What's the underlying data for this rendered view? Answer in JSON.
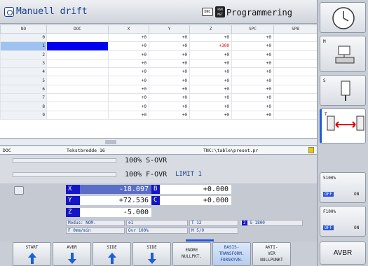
{
  "header": {
    "mode_left": "Manuell drift",
    "dnc": "DNC",
    "pgm": "PGM MGT",
    "mode_right": "Programmering"
  },
  "table": {
    "columns": [
      "NO",
      "DOC",
      "X",
      "Y",
      "Z",
      "SPC",
      "SPB"
    ],
    "rows": [
      {
        "no": "0",
        "x": "+0",
        "y": "+0",
        "z": "+0",
        "spc": "+0"
      },
      {
        "no": "1",
        "x": "+0",
        "y": "+0",
        "z": "+300",
        "spc": "+0"
      },
      {
        "no": "2",
        "x": "+0",
        "y": "+0",
        "z": "+0",
        "spc": "+0"
      },
      {
        "no": "3",
        "x": "+0",
        "y": "+0",
        "z": "+0",
        "spc": "+0"
      },
      {
        "no": "4",
        "x": "+0",
        "y": "+0",
        "z": "+0",
        "spc": "+0"
      },
      {
        "no": "5",
        "x": "+0",
        "y": "+0",
        "z": "+0",
        "spc": "+0"
      },
      {
        "no": "6",
        "x": "+0",
        "y": "+0",
        "z": "+0",
        "spc": "+0"
      },
      {
        "no": "7",
        "x": "+0",
        "y": "+0",
        "z": "+0",
        "spc": "+0"
      },
      {
        "no": "8",
        "x": "+0",
        "y": "+0",
        "z": "+0",
        "spc": "+0"
      },
      {
        "no": "9",
        "x": "+0",
        "y": "+0",
        "z": "+0",
        "spc": "+0"
      }
    ],
    "selected_row": 1
  },
  "info": {
    "field": "DOC",
    "desc": "Tekstbredde 16",
    "path": "TNC:\\table\\preset.pr"
  },
  "overrides": {
    "s_ovr": "100% S-OVR",
    "f_ovr": "100% F-OVR",
    "limit": "LIMIT 1"
  },
  "position": {
    "x_label": "X",
    "x": "-18.097",
    "b_label": "B",
    "b": "+0.000",
    "y_label": "Y",
    "y": "+72.536",
    "c_label": "C",
    "c": "+0.000",
    "z_label": "Z",
    "z": "-5.000"
  },
  "status": {
    "modus": "Modus: NOM.",
    "tool_icon": "1",
    "t": "T 12",
    "s": "S 1800",
    "f": "F 0mm/min",
    "ovr": "Ovr 100%",
    "m": "M 5/9",
    "s_icon": "2"
  },
  "softkeys": [
    "START",
    "AVBR",
    "SIDE",
    "SIDE",
    "ENDRE\nNULLPKT.",
    "BASIS-\nTRANSFORM.\nFORSKYVN.",
    "AKTI-\nVER\nNULLPUNKT",
    "AVBR"
  ],
  "right_panel": {
    "m": "M",
    "s": "S",
    "t": "T",
    "s100": "S100%",
    "f100": "F100%",
    "off": "OFF",
    "on": "ON"
  },
  "colors": {
    "axis": "#1414c8",
    "axis_value": "#5a6ec8",
    "accent": "#1a3f8f"
  }
}
